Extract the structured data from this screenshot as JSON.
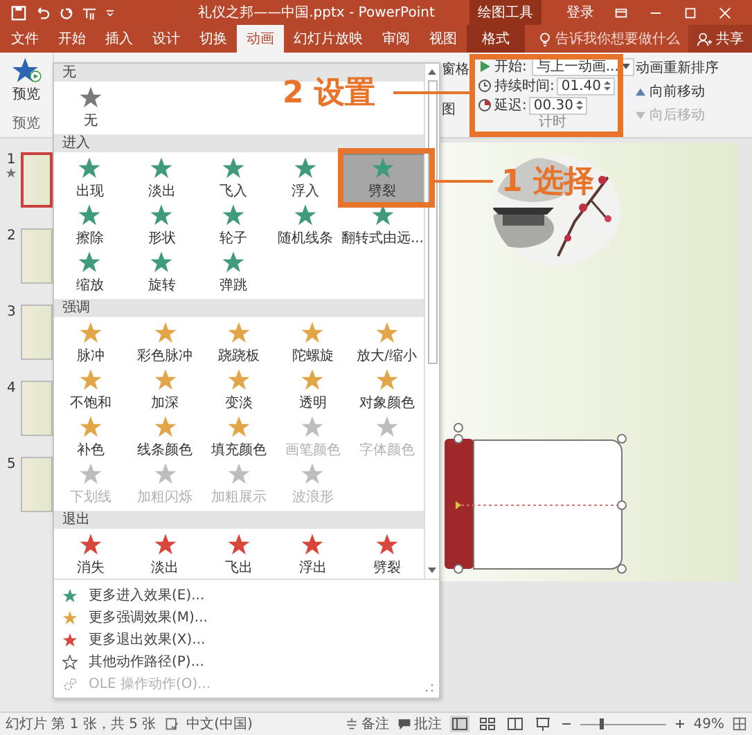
{
  "title_bar": {
    "title": "礼仪之邦——中国.pptx - PowerPoint",
    "context_label": "绘图工具",
    "sign_in": "登录"
  },
  "tabs": [
    {
      "label": "文件",
      "selected": false,
      "contextual": false
    },
    {
      "label": "开始",
      "selected": false,
      "contextual": false
    },
    {
      "label": "插入",
      "selected": false,
      "contextual": false
    },
    {
      "label": "设计",
      "selected": false,
      "contextual": false
    },
    {
      "label": "切换",
      "selected": false,
      "contextual": false
    },
    {
      "label": "动画",
      "selected": true,
      "contextual": false
    },
    {
      "label": "幻灯片放映",
      "selected": false,
      "contextual": false
    },
    {
      "label": "审阅",
      "selected": false,
      "contextual": false
    },
    {
      "label": "视图",
      "selected": false,
      "contextual": false
    },
    {
      "label": "格式",
      "selected": false,
      "contextual": true
    }
  ],
  "tell_me": "告诉我你想要做什么",
  "share": "共享",
  "ribbon": {
    "preview": {
      "label": "预览",
      "group_label": "预览"
    },
    "pane_labels": [
      "窗格",
      "图"
    ],
    "timing": {
      "start_label": "开始:",
      "start_value": "与上一动画...",
      "duration_label": "持续时间:",
      "duration_value": "01.40",
      "delay_label": "延迟:",
      "delay_value": "00.30",
      "group_label": "计时"
    },
    "reorder": {
      "title": "动画重新排序",
      "forward": {
        "label": "向前移动",
        "disabled": false
      },
      "backward": {
        "label": "向后移动",
        "disabled": true
      }
    }
  },
  "gallery": {
    "sections": [
      {
        "title": "无",
        "kind": "none",
        "items": [
          {
            "label": "无",
            "disabled": false,
            "selected": false
          }
        ]
      },
      {
        "title": "进入",
        "kind": "entrance",
        "items": [
          {
            "label": "出现",
            "disabled": false,
            "selected": false
          },
          {
            "label": "淡出",
            "disabled": false,
            "selected": false
          },
          {
            "label": "飞入",
            "disabled": false,
            "selected": false
          },
          {
            "label": "浮入",
            "disabled": false,
            "selected": false
          },
          {
            "label": "劈裂",
            "disabled": false,
            "selected": true
          },
          {
            "label": "擦除",
            "disabled": false,
            "selected": false
          },
          {
            "label": "形状",
            "disabled": false,
            "selected": false
          },
          {
            "label": "轮子",
            "disabled": false,
            "selected": false
          },
          {
            "label": "随机线条",
            "disabled": false,
            "selected": false
          },
          {
            "label": "翻转式由远...",
            "disabled": false,
            "selected": false
          },
          {
            "label": "缩放",
            "disabled": false,
            "selected": false
          },
          {
            "label": "旋转",
            "disabled": false,
            "selected": false
          },
          {
            "label": "弹跳",
            "disabled": false,
            "selected": false
          }
        ]
      },
      {
        "title": "强调",
        "kind": "emphasis",
        "items": [
          {
            "label": "脉冲",
            "disabled": false,
            "selected": false
          },
          {
            "label": "彩色脉冲",
            "disabled": false,
            "selected": false
          },
          {
            "label": "跷跷板",
            "disabled": false,
            "selected": false
          },
          {
            "label": "陀螺旋",
            "disabled": false,
            "selected": false
          },
          {
            "label": "放大/缩小",
            "disabled": false,
            "selected": false
          },
          {
            "label": "不饱和",
            "disabled": false,
            "selected": false
          },
          {
            "label": "加深",
            "disabled": false,
            "selected": false
          },
          {
            "label": "变淡",
            "disabled": false,
            "selected": false
          },
          {
            "label": "透明",
            "disabled": false,
            "selected": false
          },
          {
            "label": "对象颜色",
            "disabled": false,
            "selected": false
          },
          {
            "label": "补色",
            "disabled": false,
            "selected": false
          },
          {
            "label": "线条颜色",
            "disabled": false,
            "selected": false
          },
          {
            "label": "填充颜色",
            "disabled": false,
            "selected": false
          },
          {
            "label": "画笔颜色",
            "disabled": true,
            "selected": false
          },
          {
            "label": "字体颜色",
            "disabled": true,
            "selected": false
          },
          {
            "label": "下划线",
            "disabled": true,
            "selected": false
          },
          {
            "label": "加粗闪烁",
            "disabled": true,
            "selected": false
          },
          {
            "label": "加粗展示",
            "disabled": true,
            "selected": false
          },
          {
            "label": "波浪形",
            "disabled": true,
            "selected": false
          }
        ]
      },
      {
        "title": "退出",
        "kind": "exit",
        "items": [
          {
            "label": "消失",
            "disabled": false,
            "selected": false
          },
          {
            "label": "淡出",
            "disabled": false,
            "selected": false
          },
          {
            "label": "飞出",
            "disabled": false,
            "selected": false
          },
          {
            "label": "浮出",
            "disabled": false,
            "selected": false
          },
          {
            "label": "劈裂",
            "disabled": false,
            "selected": false
          }
        ]
      }
    ],
    "menu": [
      {
        "label": "更多进入效果(E)...",
        "kind": "entrance",
        "disabled": false
      },
      {
        "label": "更多强调效果(M)...",
        "kind": "emphasis",
        "disabled": false
      },
      {
        "label": "更多退出效果(X)...",
        "kind": "exit",
        "disabled": false
      },
      {
        "label": "其他动作路径(P)...",
        "kind": "path",
        "disabled": false
      },
      {
        "label": "OLE 操作动作(O)...",
        "kind": "ole",
        "disabled": true
      }
    ]
  },
  "slides": [
    {
      "number": "1",
      "selected": true,
      "animated": true
    },
    {
      "number": "2",
      "selected": false,
      "animated": false
    },
    {
      "number": "3",
      "selected": false,
      "animated": false
    },
    {
      "number": "4",
      "selected": false,
      "animated": false
    },
    {
      "number": "5",
      "selected": false,
      "animated": false
    }
  ],
  "status_bar": {
    "slide_info": "幻灯片 第 1 张，共 5 张",
    "language": "中文(中国)",
    "notes": "备注",
    "comments": "批注",
    "zoom_slider": {
      "level": 0.25
    },
    "zoom": "49%"
  },
  "callouts": [
    {
      "text": "2 设置"
    },
    {
      "text": "1 选择"
    }
  ]
}
